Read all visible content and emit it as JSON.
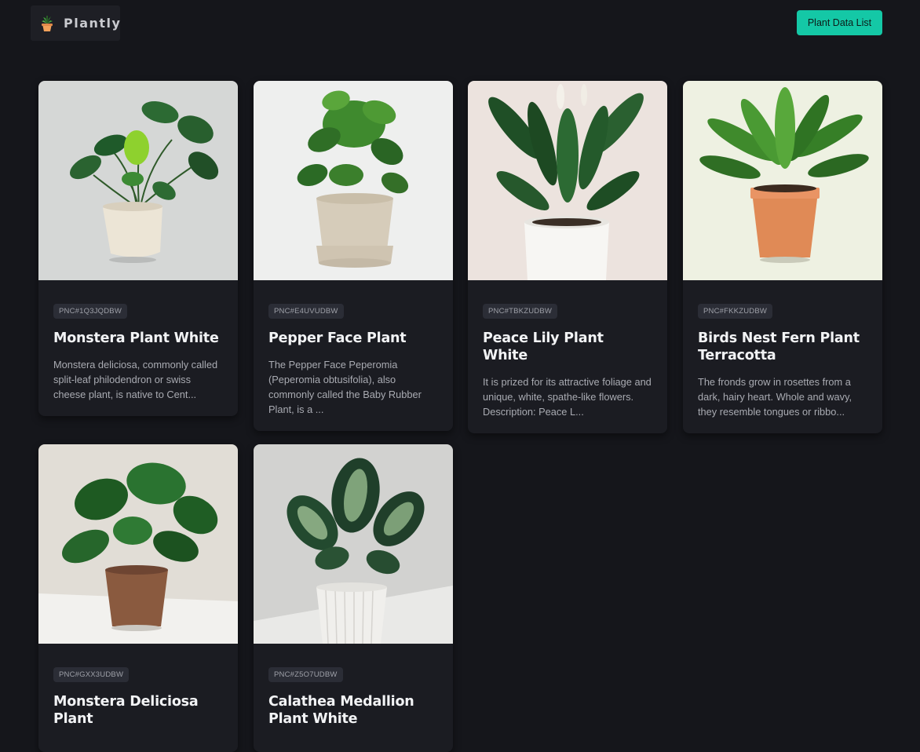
{
  "nav": {
    "brand": "Plantly",
    "brand_icon": "potted-plant-icon",
    "data_list_button": "Plant Data List"
  },
  "plants": [
    {
      "code": "PNC#1Q3JQDBW",
      "name": "Monstera Plant White",
      "description": "Monstera deliciosa, commonly called split-leaf philodendron or swiss cheese plant, is native to Cent..."
    },
    {
      "code": "PNC#E4UVUDBW",
      "name": "Pepper Face Plant",
      "description": "The Pepper Face Peperomia (Peperomia obtusifolia), also commonly called the Baby Rubber Plant, is a ..."
    },
    {
      "code": "PNC#TBKZUDBW",
      "name": "Peace Lily Plant White",
      "description": "It is prized for its attractive foliage and unique, white, spathe-like flowers. Description: Peace L..."
    },
    {
      "code": "PNC#FKKZUDBW",
      "name": "Birds Nest Fern Plant Terracotta",
      "description": "The fronds grow in rosettes from a dark, hairy heart. Whole and wavy, they resemble tongues or ribbo..."
    },
    {
      "code": "PNC#GXX3UDBW",
      "name": "Monstera Deliciosa Plant",
      "description": ""
    },
    {
      "code": "PNC#Z5O7UDBW",
      "name": "Calathea Medallion Plant White",
      "description": ""
    }
  ],
  "colors": {
    "background": "#15161b",
    "card": "#1b1c22",
    "accent": "#14c8a6",
    "badge": "#2b2d36"
  }
}
